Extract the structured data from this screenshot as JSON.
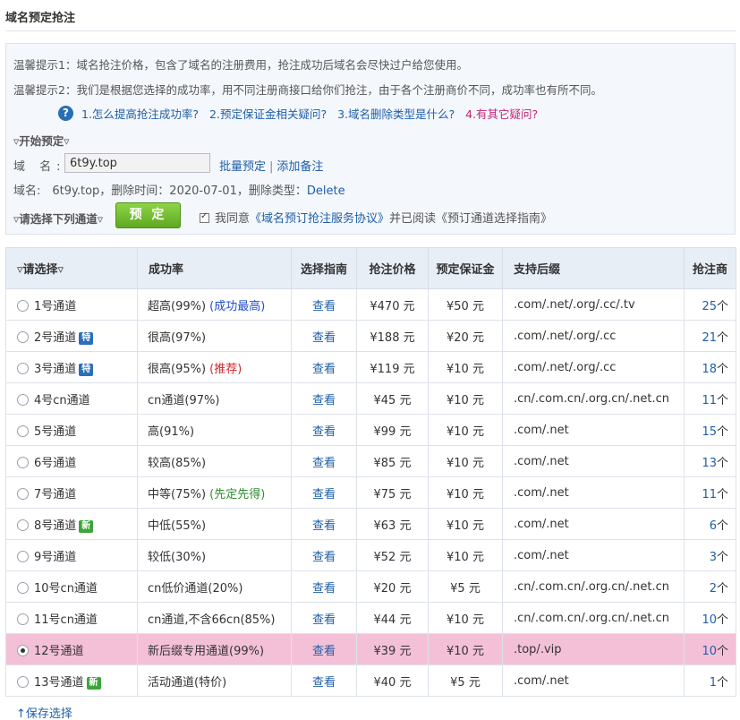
{
  "page": {
    "title": "域名预定抢注"
  },
  "tips": {
    "tip1": "温馨提示1：域名抢注价格，包含了域名的注册费用，抢注成功后域名会尽快过户给您使用。",
    "tip2": "温馨提示2：我们是根据您选择的成功率，用不同注册商接口给你们抢注，由于各个注册商价不同，成功率也有所不同。"
  },
  "faq": {
    "links": [
      "1.怎么提高抢注成功率?",
      "2.预定保证金相关疑问?",
      "3.域名删除类型是什么?",
      "4.有其它疑问?"
    ]
  },
  "form": {
    "start_label": "▿开始预定▿",
    "domain_label": "域 名:",
    "domain_value": "6t9y.top",
    "batch_link": "批量预定",
    "separator": "|",
    "note_link": "添加备注",
    "domain_info_prefix": "域名:　6t9y.top，删除时间：2020-07-01，删除类型：",
    "delete_type": "Delete",
    "channel_label": "▿请选择下列通道▿",
    "reserve_button": "预 定",
    "agree_prefix": "我同意",
    "agreement_link": "《域名预订抢注服务协议》",
    "agree_suffix": "并已阅读《预订通道选择指南》"
  },
  "table": {
    "headers": [
      "▿请选择▿",
      "成功率",
      "选择指南",
      "抢注价格",
      "预定保证金",
      "支持后缀",
      "抢注商"
    ],
    "rows": [
      {
        "name": "1号通道",
        "badge": "",
        "rate": "超高(99%) ",
        "note": "(成功最高)",
        "guide": "查看",
        "price": "¥470 元",
        "deposit": "¥50 元",
        "suffix": ".com/.net/.org/.cc/.tv",
        "count": "25",
        "unit": "个"
      },
      {
        "name": "2号通道",
        "badge": "特",
        "rate": "很高(97%)",
        "note": "",
        "guide": "查看",
        "price": "¥188 元",
        "deposit": "¥20 元",
        "suffix": ".com/.net/.org/.cc",
        "count": "21",
        "unit": "个"
      },
      {
        "name": "3号通道",
        "badge": "特",
        "rate": "很高(95%) ",
        "note": "(推荐)",
        "guide": "查看",
        "price": "¥119 元",
        "deposit": "¥10 元",
        "suffix": ".com/.net/.org/.cc",
        "count": "18",
        "unit": "个"
      },
      {
        "name": "4号cn通道",
        "badge": "",
        "rate": "cn通道(97%)",
        "note": "",
        "guide": "查看",
        "price": "¥45 元",
        "deposit": "¥10 元",
        "suffix": ".cn/.com.cn/.org.cn/.net.cn",
        "count": "11",
        "unit": "个"
      },
      {
        "name": "5号通道",
        "badge": "",
        "rate": "高(91%)",
        "note": "",
        "guide": "查看",
        "price": "¥99 元",
        "deposit": "¥10 元",
        "suffix": ".com/.net",
        "count": "15",
        "unit": "个"
      },
      {
        "name": "6号通道",
        "badge": "",
        "rate": "较高(85%)",
        "note": "",
        "guide": "查看",
        "price": "¥85 元",
        "deposit": "¥10 元",
        "suffix": ".com/.net",
        "count": "13",
        "unit": "个"
      },
      {
        "name": "7号通道",
        "badge": "",
        "rate": "中等(75%) ",
        "note": "(先定先得)",
        "guide": "查看",
        "price": "¥75 元",
        "deposit": "¥10 元",
        "suffix": ".com/.net",
        "count": "11",
        "unit": "个"
      },
      {
        "name": "8号通道",
        "badge": "新",
        "rate": "中低(55%)",
        "note": "",
        "guide": "查看",
        "price": "¥63 元",
        "deposit": "¥10 元",
        "suffix": ".com/.net",
        "count": "6",
        "unit": "个"
      },
      {
        "name": "9号通道",
        "badge": "",
        "rate": "较低(30%)",
        "note": "",
        "guide": "查看",
        "price": "¥52 元",
        "deposit": "¥10 元",
        "suffix": ".com/.net",
        "count": "3",
        "unit": "个"
      },
      {
        "name": "10号cn通道",
        "badge": "",
        "rate": "cn低价通道(20%)",
        "note": "",
        "guide": "查看",
        "price": "¥20 元",
        "deposit": "¥5 元",
        "suffix": ".cn/.com.cn/.org.cn/.net.cn",
        "count": "2",
        "unit": "个"
      },
      {
        "name": "11号cn通道",
        "badge": "",
        "rate": "cn通道,不含66cn(85%)",
        "note": "",
        "guide": "查看",
        "price": "¥44 元",
        "deposit": "¥10 元",
        "suffix": ".cn/.com.cn/.org.cn/.net.cn",
        "count": "10",
        "unit": "个"
      },
      {
        "name": "12号通道",
        "badge": "",
        "rate": "新后缀专用通道(99%)",
        "note": "",
        "guide": "查看",
        "price": "¥39 元",
        "deposit": "¥10 元",
        "suffix": ".top/.vip",
        "count": "10",
        "unit": "个"
      },
      {
        "name": "13号通道",
        "badge": "新",
        "rate": "活动通道(特价)",
        "note": "",
        "guide": "查看",
        "price": "¥40 元",
        "deposit": "¥5 元",
        "suffix": ".com/.net",
        "count": "1",
        "unit": "个"
      }
    ],
    "selected_index": 11
  },
  "footer": {
    "save_link": "↑保存选择"
  },
  "colors": {
    "link": "#1f5fa8",
    "price": "#c0281f",
    "selected_row": "#f4c0d8",
    "button_green": "#6cb82b",
    "header_bg": "#e8eef6"
  }
}
